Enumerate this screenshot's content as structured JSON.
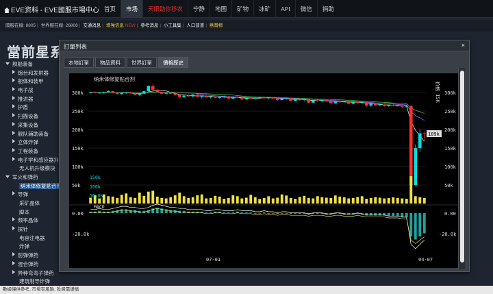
{
  "brand": {
    "title": "EVE资料 - EVE國服市場中心"
  },
  "nav": [
    {
      "label": "首页",
      "state": "normal"
    },
    {
      "label": "市场",
      "state": "active"
    },
    {
      "label": "天眼助你移农",
      "state": "red"
    },
    {
      "label": "宁静",
      "state": "normal"
    },
    {
      "label": "地图",
      "state": "normal"
    },
    {
      "label": "矿物",
      "state": "normal"
    },
    {
      "label": "冰矿",
      "state": "normal"
    },
    {
      "label": "API",
      "state": "normal"
    },
    {
      "label": "微信",
      "state": "normal"
    },
    {
      "label": "捐助",
      "state": "normal"
    }
  ],
  "status": {
    "online": "國服在線: 8805",
    "world_online": "世界服在線: 26808",
    "link1": "交通消息",
    "link2": "增強信息",
    "new_badge": "NEW",
    "link3": "參考消息",
    "link4": "小工具集",
    "link5": "人口普查",
    "link6": "懸賞榜"
  },
  "page_title": "當前星系",
  "tree": [
    {
      "label": "舰船装备",
      "level": 0,
      "state": "down"
    },
    {
      "label": "炮台和发射器",
      "level": 1,
      "state": "right"
    },
    {
      "label": "船体和装甲",
      "level": 1,
      "state": "right"
    },
    {
      "label": "电子战",
      "level": 1,
      "state": "right"
    },
    {
      "label": "推进器",
      "level": 1,
      "state": "right"
    },
    {
      "label": "护盾",
      "level": 1,
      "state": "right"
    },
    {
      "label": "扫描设备",
      "level": 1,
      "state": "right"
    },
    {
      "label": "采集设备",
      "level": 1,
      "state": "right"
    },
    {
      "label": "舰队辅助装备",
      "level": 1,
      "state": "right"
    },
    {
      "label": "立体炸弹",
      "level": 1,
      "state": "right"
    },
    {
      "label": "工程装备",
      "level": 1,
      "state": "right"
    },
    {
      "label": "电子学和感应器升",
      "level": 1,
      "state": "right"
    },
    {
      "label": "无人机升级模块",
      "level": 2,
      "state": "none"
    },
    {
      "label": "军火和弹药",
      "level": 0,
      "state": "down"
    },
    {
      "label": "纳米体修复贴合剂",
      "level": 2,
      "state": "selected"
    },
    {
      "label": "导弹",
      "level": 1,
      "state": "right"
    },
    {
      "label": "采矿晶体",
      "level": 2,
      "state": "none"
    },
    {
      "label": "脚本",
      "level": 2,
      "state": "none"
    },
    {
      "label": "频率晶体",
      "level": 1,
      "state": "right"
    },
    {
      "label": "探针",
      "level": 1,
      "state": "right"
    },
    {
      "label": "电容注电器",
      "level": 2,
      "state": "none"
    },
    {
      "label": "炸弹",
      "level": 2,
      "state": "none"
    },
    {
      "label": "射弹弹药",
      "level": 1,
      "state": "right"
    },
    {
      "label": "混合弹药",
      "level": 1,
      "state": "right"
    },
    {
      "label": "异种弯弯子弹药",
      "level": 1,
      "state": "right"
    },
    {
      "label": "建筑制导炸弹",
      "level": 2,
      "state": "none"
    }
  ],
  "footer": "數據僅供參考, 市場有風險, 投資需謹慎",
  "modal": {
    "title": "訂單列表",
    "close": "×",
    "tabs": [
      {
        "label": "本地訂單",
        "active": false
      },
      {
        "label": "物品資料",
        "active": false
      },
      {
        "label": "世界訂單",
        "active": false
      },
      {
        "label": "價格歷史",
        "active": true
      }
    ]
  },
  "chart_data": {
    "type": "candlestick",
    "title": "纳米体修复贴合剂",
    "ylabel": "价格 ISK",
    "x_ticks": [
      "07-01",
      "04-07"
    ],
    "price_ticks": [
      "300k",
      "250k",
      "200k",
      "150k",
      "100k",
      "50k"
    ],
    "price_ylim": [
      0,
      330000
    ],
    "last_price_label": "189k",
    "volume_ticks": [
      "150k",
      "100k",
      "50.0k"
    ],
    "macd_label": "MACD",
    "macd_ticks": [
      "0.00",
      "-20.0k"
    ],
    "colors": {
      "up": "#00e0e0",
      "down": "#ff3030",
      "volume": "#f0e040",
      "ma1": "#e0e0e0",
      "ma2": "#9060ff",
      "ma3": "#40c040",
      "background": "#000000"
    },
    "candles": [
      [
        300000,
        302000,
        298000,
        301000
      ],
      [
        301000,
        304000,
        299000,
        299000
      ],
      [
        299000,
        301000,
        297000,
        300000
      ],
      [
        300000,
        303000,
        298000,
        302000
      ],
      [
        302000,
        306000,
        300000,
        304000
      ],
      [
        304000,
        305000,
        298000,
        299000
      ],
      [
        299000,
        300000,
        295000,
        296000
      ],
      [
        296000,
        300000,
        294000,
        299000
      ],
      [
        299000,
        302000,
        297000,
        301000
      ],
      [
        301000,
        303000,
        298000,
        298000
      ],
      [
        298000,
        300000,
        292000,
        294000
      ],
      [
        294000,
        298000,
        292000,
        297000
      ],
      [
        297000,
        305000,
        296000,
        304000
      ],
      [
        304000,
        320000,
        302000,
        318000
      ],
      [
        318000,
        325000,
        306000,
        308000
      ],
      [
        308000,
        310000,
        300000,
        302000
      ],
      [
        302000,
        303000,
        295000,
        297000
      ],
      [
        297000,
        300000,
        294000,
        299000
      ],
      [
        299000,
        301000,
        296000,
        297000
      ],
      [
        297000,
        299000,
        292000,
        294000
      ],
      [
        294000,
        296000,
        285000,
        288000
      ],
      [
        288000,
        294000,
        286000,
        292000
      ],
      [
        292000,
        295000,
        289000,
        290000
      ],
      [
        290000,
        296000,
        288000,
        295000
      ],
      [
        295000,
        297000,
        287000,
        289000
      ],
      [
        289000,
        292000,
        284000,
        291000
      ],
      [
        291000,
        293000,
        286000,
        287000
      ],
      [
        287000,
        290000,
        284000,
        289000
      ],
      [
        289000,
        291000,
        285000,
        286000
      ],
      [
        286000,
        290000,
        283000,
        288000
      ],
      [
        288000,
        292000,
        286000,
        290000
      ],
      [
        290000,
        291000,
        282000,
        284000
      ],
      [
        284000,
        289000,
        282000,
        288000
      ],
      [
        288000,
        290000,
        285000,
        286000
      ],
      [
        286000,
        288000,
        280000,
        282000
      ],
      [
        282000,
        287000,
        280000,
        286000
      ],
      [
        286000,
        288000,
        283000,
        284000
      ],
      [
        284000,
        287000,
        281000,
        286000
      ],
      [
        286000,
        289000,
        284000,
        288000
      ],
      [
        288000,
        290000,
        284000,
        285000
      ],
      [
        285000,
        288000,
        282000,
        287000
      ],
      [
        287000,
        289000,
        283000,
        284000
      ],
      [
        284000,
        286000,
        278000,
        280000
      ],
      [
        280000,
        285000,
        279000,
        284000
      ],
      [
        284000,
        287000,
        282000,
        285000
      ],
      [
        285000,
        287000,
        276000,
        278000
      ],
      [
        278000,
        283000,
        277000,
        282000
      ],
      [
        282000,
        284000,
        278000,
        280000
      ],
      [
        280000,
        283000,
        277000,
        282000
      ],
      [
        282000,
        284000,
        270000,
        273000
      ],
      [
        273000,
        280000,
        272000,
        279000
      ],
      [
        279000,
        282000,
        276000,
        277000
      ],
      [
        277000,
        281000,
        275000,
        280000
      ],
      [
        280000,
        282000,
        276000,
        277000
      ],
      [
        277000,
        280000,
        270000,
        271000
      ],
      [
        271000,
        278000,
        270000,
        277000
      ],
      [
        277000,
        279000,
        272000,
        274000
      ],
      [
        274000,
        278000,
        273000,
        277000
      ],
      [
        277000,
        279000,
        268000,
        270000
      ],
      [
        270000,
        276000,
        268000,
        275000
      ],
      [
        275000,
        277000,
        270000,
        272000
      ],
      [
        272000,
        276000,
        270000,
        274000
      ],
      [
        274000,
        276000,
        262000,
        265000
      ],
      [
        265000,
        272000,
        262000,
        270000
      ],
      [
        270000,
        272000,
        264000,
        266000
      ],
      [
        266000,
        270000,
        264000,
        268000
      ],
      [
        268000,
        270000,
        262000,
        264000
      ],
      [
        264000,
        268000,
        262000,
        267000
      ],
      [
        267000,
        270000,
        263000,
        265000
      ],
      [
        265000,
        268000,
        262000,
        264000
      ],
      [
        264000,
        266000,
        258000,
        262000
      ],
      [
        262000,
        266000,
        260000,
        264000
      ],
      [
        264000,
        266000,
        40000,
        50000
      ],
      [
        50000,
        160000,
        48000,
        150000
      ],
      [
        150000,
        200000,
        140000,
        190000
      ],
      [
        190000,
        195000,
        170000,
        189000
      ]
    ],
    "volumes": [
      32,
      45,
      28,
      50,
      40,
      38,
      30,
      48,
      55,
      35,
      30,
      60,
      42,
      65,
      70,
      38,
      30,
      28,
      35,
      45,
      60,
      40,
      30,
      35,
      45,
      50,
      28,
      30,
      42,
      38,
      26,
      30,
      45,
      40,
      28,
      32,
      48,
      35,
      25,
      30,
      40,
      28,
      32,
      50,
      44,
      30,
      26,
      36,
      42,
      30,
      28,
      40,
      35,
      32,
      30,
      44,
      38,
      34,
      28,
      30,
      36,
      40,
      26,
      30,
      35,
      32,
      28,
      30,
      34,
      30,
      28,
      26,
      150,
      40,
      35,
      30
    ],
    "macd": [
      2,
      2,
      3,
      2,
      2,
      3,
      4,
      5,
      5,
      4,
      4,
      3,
      3,
      4,
      6,
      7,
      6,
      5,
      4,
      4,
      3,
      3,
      2,
      2,
      2,
      2,
      1,
      1,
      2,
      2,
      1,
      1,
      1,
      2,
      1,
      1,
      1,
      0,
      0,
      1,
      0,
      0,
      -1,
      0,
      0,
      -1,
      -1,
      -1,
      -1,
      -2,
      -1,
      -1,
      -1,
      -2,
      -2,
      -1,
      -1,
      -2,
      -2,
      -2,
      -1,
      -2,
      -3,
      -3,
      -3,
      -3,
      -3,
      -4,
      -4,
      -4,
      -5,
      -5,
      -30,
      -34,
      -30,
      -26
    ]
  }
}
